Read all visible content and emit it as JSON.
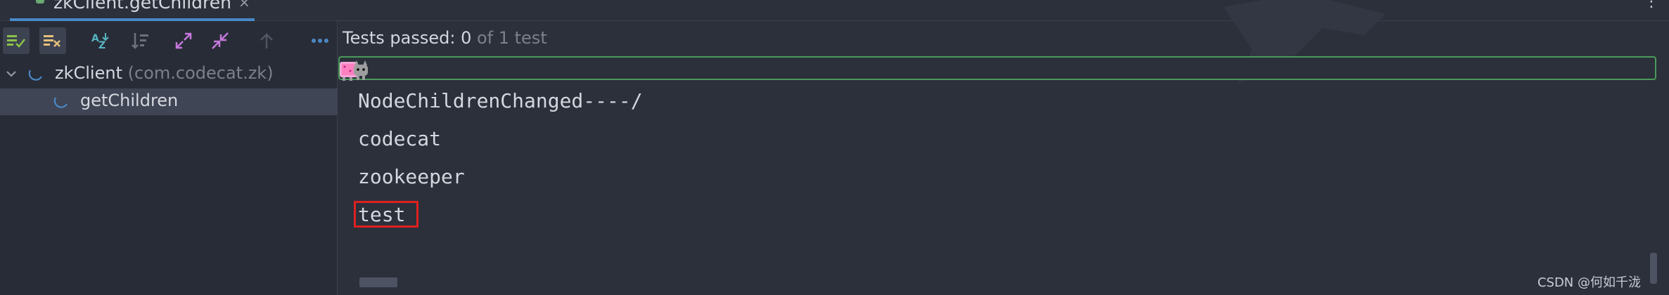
{
  "tab": {
    "title": "zkClient.getChildren",
    "close_icon": "×",
    "more_icon": "⋮"
  },
  "toolbar": {
    "buttons": [
      {
        "name": "show-passed-button",
        "icon": "show-passed-icon",
        "active": true
      },
      {
        "name": "show-ignored-button",
        "icon": "show-ignored-icon",
        "active": true
      },
      {
        "name": "sort-alphabetically-button",
        "icon": "sort-az-icon",
        "active": false
      },
      {
        "name": "sort-by-duration-button",
        "icon": "sort-duration-icon",
        "active": false
      },
      {
        "name": "expand-all-button",
        "icon": "expand-all-icon",
        "active": false
      },
      {
        "name": "collapse-all-button",
        "icon": "collapse-all-icon",
        "active": false
      },
      {
        "name": "previous-failed-button",
        "icon": "arrow-up-icon",
        "active": false
      },
      {
        "name": "more-options-button",
        "icon": "ellipsis-icon",
        "active": false
      }
    ]
  },
  "tree": {
    "root": {
      "label": "zkClient",
      "package": "(com.codecat.zk)"
    },
    "child": {
      "label": "getChildren"
    }
  },
  "status": {
    "prefix": "Tests passed: ",
    "passed": "0",
    "suffix": " of 1 test"
  },
  "console": {
    "lines": [
      "NodeChildrenChanged----/",
      "codecat",
      "zookeeper",
      "test"
    ]
  },
  "watermark": "CSDN @何如千泷",
  "colors": {
    "accent_blue": "#4a88c7",
    "progress_green": "#4a9a5a",
    "highlight_red": "#e02020",
    "selection": "#3f4554"
  }
}
